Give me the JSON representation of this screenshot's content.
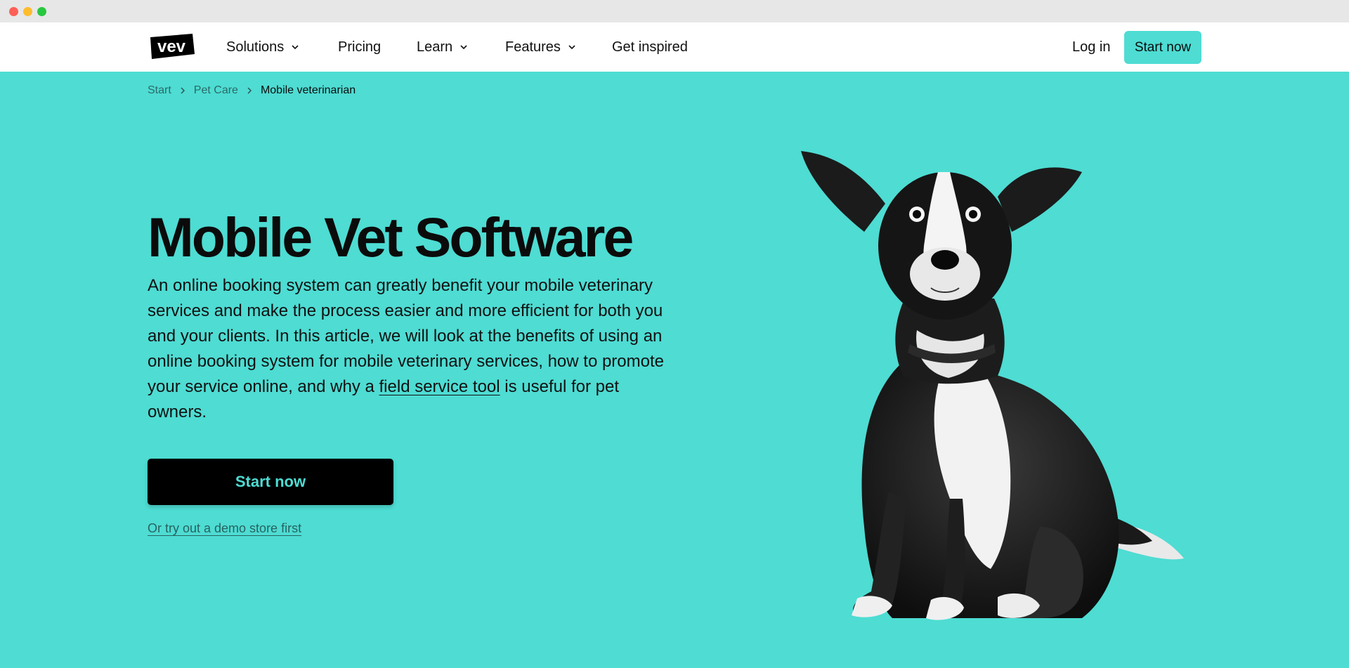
{
  "nav": {
    "logo_text": "vev",
    "items": [
      {
        "label": "Solutions",
        "has_dropdown": true
      },
      {
        "label": "Pricing",
        "has_dropdown": false
      },
      {
        "label": "Learn",
        "has_dropdown": true
      },
      {
        "label": "Features",
        "has_dropdown": true
      },
      {
        "label": "Get inspired",
        "has_dropdown": false
      }
    ],
    "login_label": "Log in",
    "cta_label": "Start now"
  },
  "breadcrumb": {
    "items": [
      "Start",
      "Pet Care"
    ],
    "current": "Mobile veterinarian"
  },
  "hero": {
    "title": "Mobile Vet Software",
    "text_before_link": "An online booking system can greatly benefit your mobile veterinary services and make the process easier and more efficient for both you and your clients. In this article, we will look at the benefits of using an online booking system for mobile veterinary services, how to promote your service online, and why a ",
    "link_text": "field service tool",
    "text_after_link": " is useful for pet owners.",
    "cta_label": "Start now",
    "demo_link": "Or try out a demo store first"
  },
  "colors": {
    "accent": "#4EDCD3",
    "dark": "#000000",
    "nav_bg": "#FFFFFF"
  }
}
